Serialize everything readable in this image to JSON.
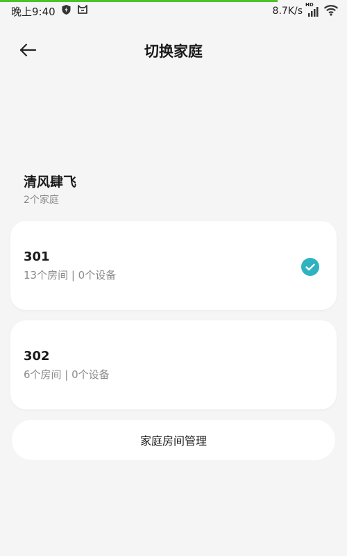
{
  "status_bar": {
    "time": "晚上9:40",
    "net_speed": "8.7K/s",
    "hd_label": "HD",
    "progress": 0.8,
    "icons": [
      "shield-icon",
      "mi-home-icon",
      "signal-icon",
      "wifi-icon"
    ]
  },
  "header": {
    "title": "切换家庭",
    "back_icon": "arrow-left-icon"
  },
  "home_owner": {
    "name": "清风肆飞",
    "count": "2个家庭"
  },
  "homes": [
    {
      "name": "301",
      "detail": "13个房间 | 0个设备",
      "selected": true
    },
    {
      "name": "302",
      "detail": "6个房间 | 0个设备",
      "selected": false
    }
  ],
  "manage_button": {
    "label": "家庭房间管理"
  },
  "colors": {
    "accent": "#2fb3c0",
    "progress": "#4cc429",
    "background": "#f5f5f5"
  }
}
